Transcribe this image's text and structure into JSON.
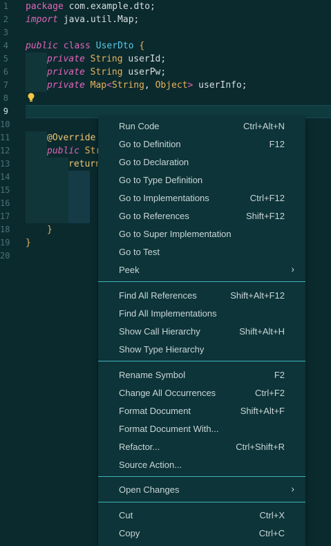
{
  "editor": {
    "line_numbers": [
      "1",
      "2",
      "3",
      "4",
      "5",
      "6",
      "7",
      "8",
      "9",
      "10",
      "11",
      "12",
      "13",
      "14",
      "15",
      "16",
      "17",
      "18",
      "19",
      "20"
    ],
    "active_line": "9",
    "lines": {
      "l1": {
        "kw": "package",
        "rest": " com.example.dto;"
      },
      "l2": {
        "kw": "import",
        "rest": " java.util.Map;"
      },
      "l4": {
        "kw1": "public",
        "kw2": " class ",
        "name": "UserDto",
        "brace": " {"
      },
      "l5": {
        "kw": "private",
        "type": " String",
        "rest": " userId;"
      },
      "l6": {
        "kw": "private",
        "type": " String",
        "rest": " userPw;"
      },
      "l7": {
        "kw": "private",
        "type": " Map",
        "lt": "<",
        "t1": "String",
        "comma": ", ",
        "t2": "Object",
        "gt": ">",
        "rest": " userInfo;"
      },
      "l11": {
        "ann": "@Override"
      },
      "l12": {
        "kw": "public",
        "type": " Str"
      },
      "l13": {
        "kw": "return"
      },
      "l18": {
        "brace": "}"
      },
      "l19": {
        "brace": "}"
      }
    }
  },
  "context_menu": {
    "group1": [
      {
        "label": "Run Code",
        "key": "Ctrl+Alt+N"
      },
      {
        "label": "Go to Definition",
        "key": "F12"
      },
      {
        "label": "Go to Declaration",
        "key": ""
      },
      {
        "label": "Go to Type Definition",
        "key": ""
      },
      {
        "label": "Go to Implementations",
        "key": "Ctrl+F12"
      },
      {
        "label": "Go to References",
        "key": "Shift+F12"
      },
      {
        "label": "Go to Super Implementation",
        "key": ""
      },
      {
        "label": "Go to Test",
        "key": ""
      },
      {
        "label": "Peek",
        "key": "",
        "arrow": "›"
      }
    ],
    "group2": [
      {
        "label": "Find All References",
        "key": "Shift+Alt+F12"
      },
      {
        "label": "Find All Implementations",
        "key": ""
      },
      {
        "label": "Show Call Hierarchy",
        "key": "Shift+Alt+H"
      },
      {
        "label": "Show Type Hierarchy",
        "key": ""
      }
    ],
    "group3": [
      {
        "label": "Rename Symbol",
        "key": "F2"
      },
      {
        "label": "Change All Occurrences",
        "key": "Ctrl+F2"
      },
      {
        "label": "Format Document",
        "key": "Shift+Alt+F"
      },
      {
        "label": "Format Document With...",
        "key": ""
      },
      {
        "label": "Refactor...",
        "key": "Ctrl+Shift+R"
      },
      {
        "label": "Source Action...",
        "key": ""
      }
    ],
    "group4": [
      {
        "label": "Open Changes",
        "key": "",
        "arrow": "›"
      }
    ],
    "group5": [
      {
        "label": "Cut",
        "key": "Ctrl+X"
      },
      {
        "label": "Copy",
        "key": "Ctrl+C"
      }
    ]
  },
  "colors": {
    "accent": "#3fb5bf",
    "background": "#0b2a2e",
    "menu_bg": "#0d3438"
  }
}
